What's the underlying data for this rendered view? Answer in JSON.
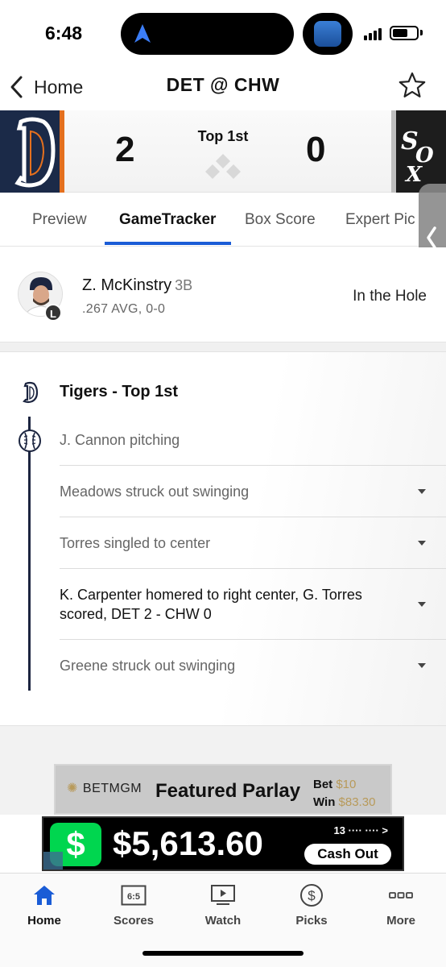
{
  "status_bar": {
    "time": "6:48"
  },
  "header": {
    "back_label": "Home",
    "title": "DET @ CHW"
  },
  "scoreboard": {
    "away_team": "DET",
    "home_team": "CHW",
    "away_score": "2",
    "home_score": "0",
    "inning": "Top 1st",
    "away_color": "#1b2a48",
    "away_accent": "#e4701e",
    "home_color": "#1d1d1d"
  },
  "tabs": [
    {
      "label": "Preview"
    },
    {
      "label": "GameTracker"
    },
    {
      "label": "Box Score"
    },
    {
      "label": "Expert Pic"
    }
  ],
  "active_tab": "GameTracker",
  "batter": {
    "name": "Z. McKinstry",
    "position": "3B",
    "stats": ".267 AVG, 0-0",
    "bats": "L",
    "status": "In the Hole"
  },
  "play_by_play": {
    "half_title": "Tigers - Top 1st",
    "pitcher": "J. Cannon pitching",
    "plays": [
      {
        "text": "Meadows struck out swinging",
        "scoring": false
      },
      {
        "text": "Torres singled to center",
        "scoring": false
      },
      {
        "text": "K. Carpenter homered to right center, G. Torres scored, DET 2 - CHW 0",
        "scoring": true
      },
      {
        "text": "Greene struck out swinging",
        "scoring": false
      }
    ]
  },
  "ad": {
    "brand": "BETMGM",
    "title": "Featured Parlay",
    "bet_label": "Bet",
    "bet_value": "$10",
    "win_label": "Win",
    "win_value": "$83.30"
  },
  "cash_banner": {
    "icon": "$",
    "amount": "$5,613.60",
    "meta": "13 ···· ···· >",
    "button": "Cash Out",
    "accent": "#00d64f"
  },
  "bottom_nav": [
    {
      "label": "Home",
      "icon": "home-icon"
    },
    {
      "label": "Scores",
      "icon": "scores-icon",
      "icon_text": "6:5"
    },
    {
      "label": "Watch",
      "icon": "watch-icon"
    },
    {
      "label": "Picks",
      "icon": "picks-icon",
      "icon_text": "$"
    },
    {
      "label": "More",
      "icon": "more-icon"
    }
  ],
  "accent_color": "#1a5cd6"
}
